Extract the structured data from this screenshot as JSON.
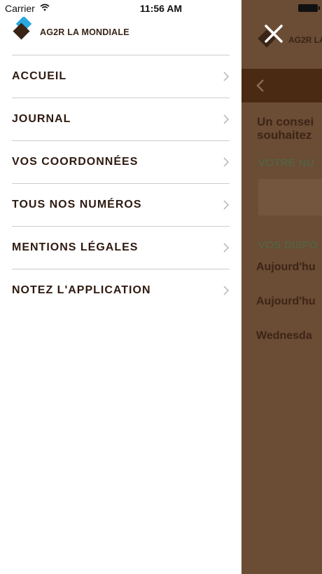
{
  "status_bar": {
    "carrier": "Carrier",
    "time": "11:56 AM"
  },
  "drawer": {
    "brand": "AG2R LA MONDIALE",
    "menu_items": [
      {
        "label": "ACCUEIL"
      },
      {
        "label": "JOURNAL"
      },
      {
        "label": "VOS COORDONNÉES"
      },
      {
        "label": "TOUS NOS NUMÉROS"
      },
      {
        "label": "MENTIONS LÉGALES"
      },
      {
        "label": "NOTEZ L'APPLICATION"
      }
    ]
  },
  "background": {
    "brand": "AG2R LA",
    "heading_line1": "Un consei",
    "heading_line2": "souhaitez",
    "label_number": "VOTRE NU",
    "label_dispo": "VOS DISPO",
    "days": [
      "Aujourd'hu",
      "Aujourd'hu",
      "Wednesda"
    ]
  },
  "colors": {
    "overlay": "#6b4c35",
    "brand_dark": "#3a2416",
    "nav_bar": "#4a2a12",
    "logo_blue": "#29a9e0"
  }
}
